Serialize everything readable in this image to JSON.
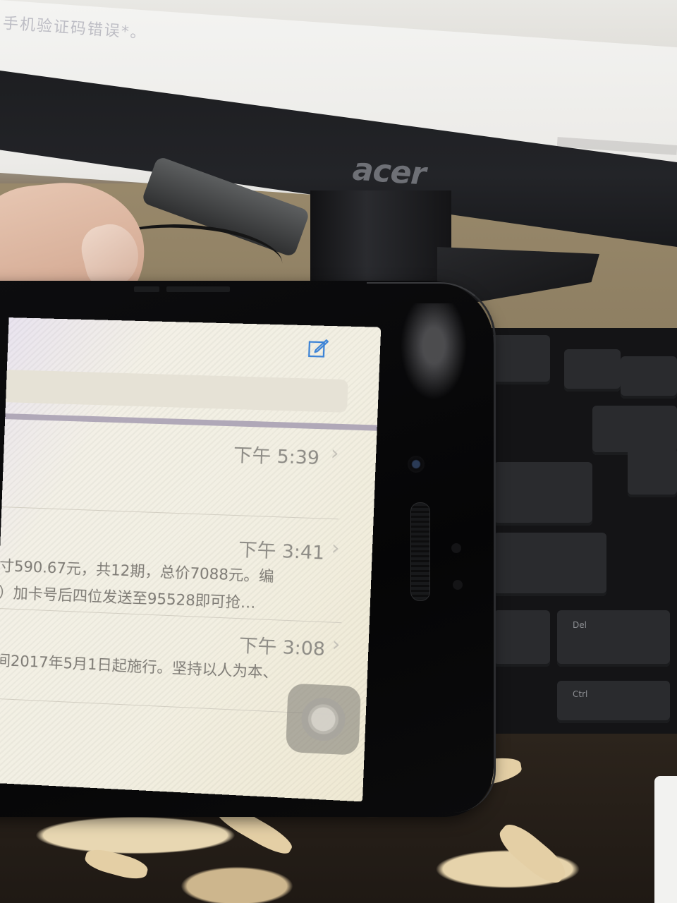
{
  "scene": {
    "monitor_brand": "acer",
    "monitor_text": "手机验证码错误*。"
  },
  "phone": {
    "compose_icon": "compose-icon",
    "search_bar": "search-field",
    "messages": [
      {
        "time": "下午 5:39",
        "chevron": "›",
        "line1": "",
        "line2": ""
      },
      {
        "time": "下午 3:41",
        "chevron": "›",
        "line1": "寸590.67元，共12期，总价7088元。编",
        "line2": "）加卡号后四位发送至95528即可抢…"
      },
      {
        "time": "下午 3:08",
        "chevron": "›",
        "line1": "间2017年5月1日起施行。坚持以人为本、",
        "line2": ""
      }
    ],
    "assistive_touch": "assistive-touch-icon"
  },
  "keyboard": {
    "keys": [
      "Del",
      "Ctrl"
    ]
  }
}
